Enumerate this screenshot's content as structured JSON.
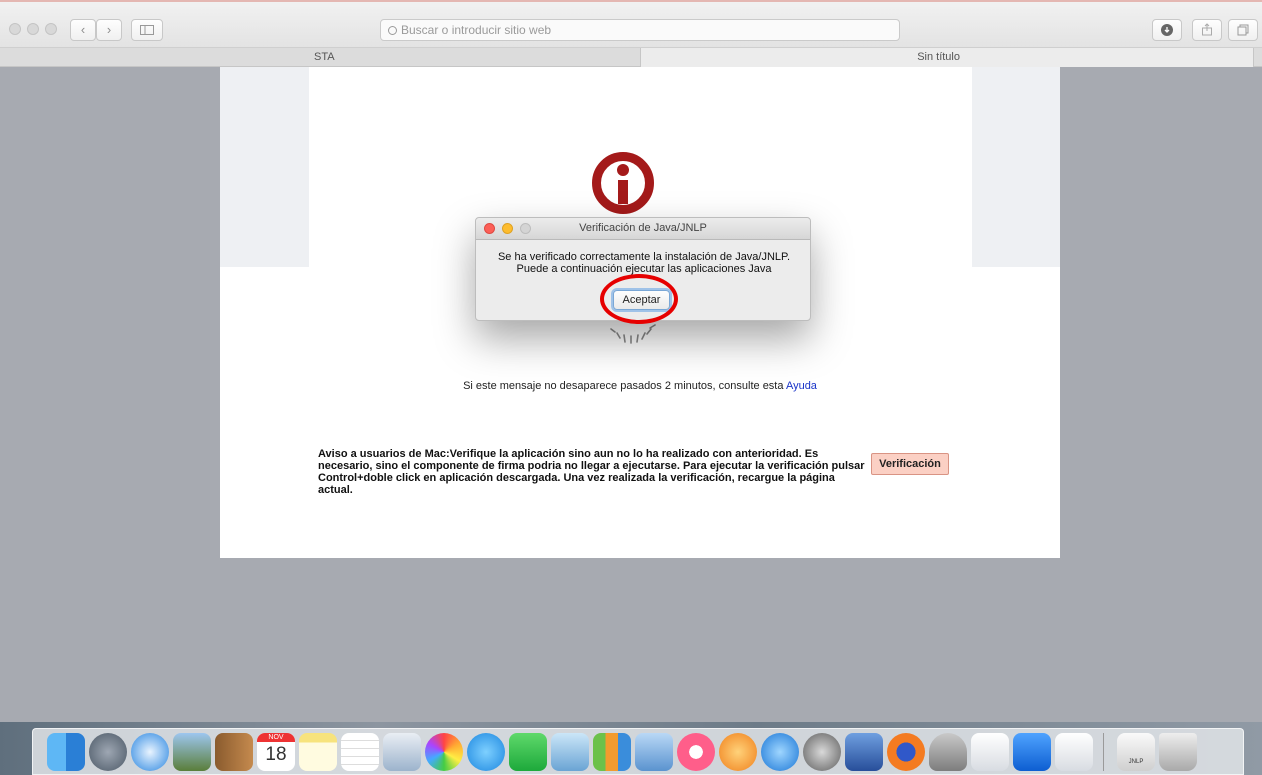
{
  "browser": {
    "address_placeholder": "Buscar o introducir sitio web",
    "tabs": [
      "STA",
      "Sin título"
    ]
  },
  "page": {
    "help_message": "Si este mensaje no desaparece pasados 2 minutos, consulte esta",
    "help_link": "Ayuda",
    "mac_notice": "Aviso a usuarios de Mac:Verifique la aplicación sino aun no lo ha realizado con anterioridad. Es necesario, sino el componente de firma podria no llegar a ejecutarse. Para ejecutar la verificación pulsar Control+doble click en aplicación descargada. Una vez realizada la verificación, recargue la página actual.",
    "verify_button": "Verificación"
  },
  "dialog": {
    "title": "Verificación de Java/JNLP",
    "line1": "Se ha verificado correctamente la instalación de Java/JNLP.",
    "line2": "Puede a continuación ejecutar las aplicaciones Java",
    "accept_button": "Aceptar"
  },
  "dock": {
    "calendar_month": "NOV",
    "calendar_day": "18",
    "jnlp_label": "JNLP"
  },
  "colors": {
    "brand_red": "#a41a1a",
    "highlight": "#e60000",
    "link": "#1a34c8",
    "verify_bg": "#fbd0c4"
  }
}
